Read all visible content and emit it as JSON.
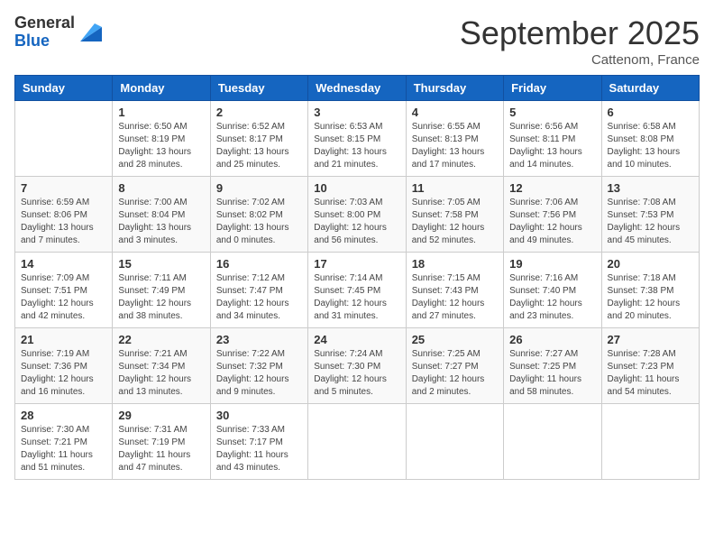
{
  "logo": {
    "general": "General",
    "blue": "Blue"
  },
  "title": "September 2025",
  "location": "Cattenom, France",
  "days_of_week": [
    "Sunday",
    "Monday",
    "Tuesday",
    "Wednesday",
    "Thursday",
    "Friday",
    "Saturday"
  ],
  "weeks": [
    [
      {
        "day": "",
        "info": ""
      },
      {
        "day": "1",
        "info": "Sunrise: 6:50 AM\nSunset: 8:19 PM\nDaylight: 13 hours\nand 28 minutes."
      },
      {
        "day": "2",
        "info": "Sunrise: 6:52 AM\nSunset: 8:17 PM\nDaylight: 13 hours\nand 25 minutes."
      },
      {
        "day": "3",
        "info": "Sunrise: 6:53 AM\nSunset: 8:15 PM\nDaylight: 13 hours\nand 21 minutes."
      },
      {
        "day": "4",
        "info": "Sunrise: 6:55 AM\nSunset: 8:13 PM\nDaylight: 13 hours\nand 17 minutes."
      },
      {
        "day": "5",
        "info": "Sunrise: 6:56 AM\nSunset: 8:11 PM\nDaylight: 13 hours\nand 14 minutes."
      },
      {
        "day": "6",
        "info": "Sunrise: 6:58 AM\nSunset: 8:08 PM\nDaylight: 13 hours\nand 10 minutes."
      }
    ],
    [
      {
        "day": "7",
        "info": "Sunrise: 6:59 AM\nSunset: 8:06 PM\nDaylight: 13 hours\nand 7 minutes."
      },
      {
        "day": "8",
        "info": "Sunrise: 7:00 AM\nSunset: 8:04 PM\nDaylight: 13 hours\nand 3 minutes."
      },
      {
        "day": "9",
        "info": "Sunrise: 7:02 AM\nSunset: 8:02 PM\nDaylight: 13 hours\nand 0 minutes."
      },
      {
        "day": "10",
        "info": "Sunrise: 7:03 AM\nSunset: 8:00 PM\nDaylight: 12 hours\nand 56 minutes."
      },
      {
        "day": "11",
        "info": "Sunrise: 7:05 AM\nSunset: 7:58 PM\nDaylight: 12 hours\nand 52 minutes."
      },
      {
        "day": "12",
        "info": "Sunrise: 7:06 AM\nSunset: 7:56 PM\nDaylight: 12 hours\nand 49 minutes."
      },
      {
        "day": "13",
        "info": "Sunrise: 7:08 AM\nSunset: 7:53 PM\nDaylight: 12 hours\nand 45 minutes."
      }
    ],
    [
      {
        "day": "14",
        "info": "Sunrise: 7:09 AM\nSunset: 7:51 PM\nDaylight: 12 hours\nand 42 minutes."
      },
      {
        "day": "15",
        "info": "Sunrise: 7:11 AM\nSunset: 7:49 PM\nDaylight: 12 hours\nand 38 minutes."
      },
      {
        "day": "16",
        "info": "Sunrise: 7:12 AM\nSunset: 7:47 PM\nDaylight: 12 hours\nand 34 minutes."
      },
      {
        "day": "17",
        "info": "Sunrise: 7:14 AM\nSunset: 7:45 PM\nDaylight: 12 hours\nand 31 minutes."
      },
      {
        "day": "18",
        "info": "Sunrise: 7:15 AM\nSunset: 7:43 PM\nDaylight: 12 hours\nand 27 minutes."
      },
      {
        "day": "19",
        "info": "Sunrise: 7:16 AM\nSunset: 7:40 PM\nDaylight: 12 hours\nand 23 minutes."
      },
      {
        "day": "20",
        "info": "Sunrise: 7:18 AM\nSunset: 7:38 PM\nDaylight: 12 hours\nand 20 minutes."
      }
    ],
    [
      {
        "day": "21",
        "info": "Sunrise: 7:19 AM\nSunset: 7:36 PM\nDaylight: 12 hours\nand 16 minutes."
      },
      {
        "day": "22",
        "info": "Sunrise: 7:21 AM\nSunset: 7:34 PM\nDaylight: 12 hours\nand 13 minutes."
      },
      {
        "day": "23",
        "info": "Sunrise: 7:22 AM\nSunset: 7:32 PM\nDaylight: 12 hours\nand 9 minutes."
      },
      {
        "day": "24",
        "info": "Sunrise: 7:24 AM\nSunset: 7:30 PM\nDaylight: 12 hours\nand 5 minutes."
      },
      {
        "day": "25",
        "info": "Sunrise: 7:25 AM\nSunset: 7:27 PM\nDaylight: 12 hours\nand 2 minutes."
      },
      {
        "day": "26",
        "info": "Sunrise: 7:27 AM\nSunset: 7:25 PM\nDaylight: 11 hours\nand 58 minutes."
      },
      {
        "day": "27",
        "info": "Sunrise: 7:28 AM\nSunset: 7:23 PM\nDaylight: 11 hours\nand 54 minutes."
      }
    ],
    [
      {
        "day": "28",
        "info": "Sunrise: 7:30 AM\nSunset: 7:21 PM\nDaylight: 11 hours\nand 51 minutes."
      },
      {
        "day": "29",
        "info": "Sunrise: 7:31 AM\nSunset: 7:19 PM\nDaylight: 11 hours\nand 47 minutes."
      },
      {
        "day": "30",
        "info": "Sunrise: 7:33 AM\nSunset: 7:17 PM\nDaylight: 11 hours\nand 43 minutes."
      },
      {
        "day": "",
        "info": ""
      },
      {
        "day": "",
        "info": ""
      },
      {
        "day": "",
        "info": ""
      },
      {
        "day": "",
        "info": ""
      }
    ]
  ]
}
